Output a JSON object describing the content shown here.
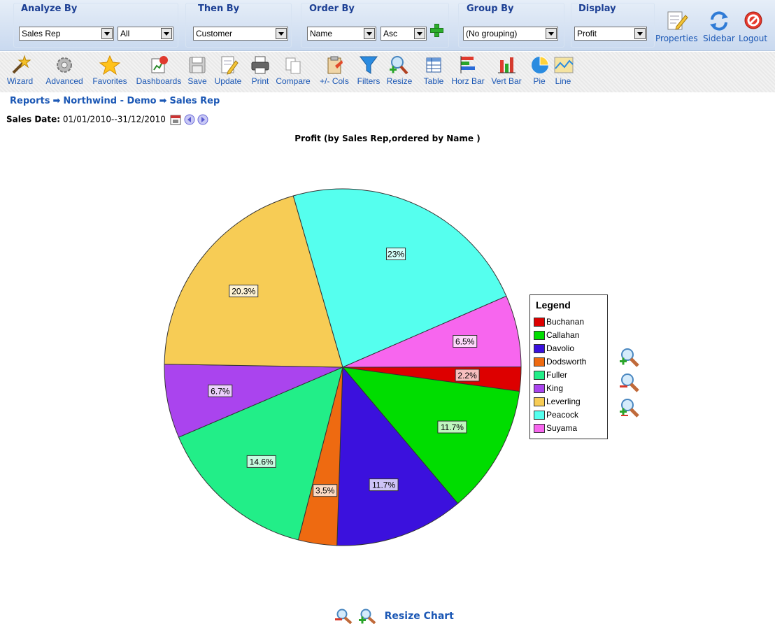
{
  "controls": {
    "analyze_by": {
      "title": "Analyze By",
      "value": "Sales Rep",
      "secondary": "All"
    },
    "then_by": {
      "title": "Then By",
      "value": "Customer"
    },
    "order_by": {
      "title": "Order By",
      "value": "Name",
      "direction": "Asc"
    },
    "group_by": {
      "title": "Group By",
      "value": "(No grouping)"
    },
    "display": {
      "title": "Display",
      "value": "Profit"
    }
  },
  "top_right": [
    {
      "label": "Properties",
      "icon": "properties-icon"
    },
    {
      "label": "Sidebar",
      "icon": "sidebar-refresh-icon"
    },
    {
      "label": "Logout",
      "icon": "logout-icon"
    }
  ],
  "toolbar": [
    {
      "label": "Wizard",
      "icon": "wizard-wand-icon"
    },
    {
      "label": "Advanced",
      "icon": "gear-icon"
    },
    {
      "label": "Favorites",
      "icon": "star-icon"
    },
    {
      "label": "Dashboards",
      "icon": "dashboard-icon"
    },
    {
      "label": "Save",
      "icon": "save-icon"
    },
    {
      "label": "Update",
      "icon": "update-icon"
    },
    {
      "label": "Print",
      "icon": "printer-icon"
    },
    {
      "label": "Compare",
      "icon": "compare-icon"
    },
    {
      "label": "+/- Cols",
      "icon": "columns-icon"
    },
    {
      "label": "Filters",
      "icon": "filter-icon"
    },
    {
      "label": "Resize",
      "icon": "resize-icon"
    },
    {
      "label": "Table",
      "icon": "table-icon"
    },
    {
      "label": "Horz Bar",
      "icon": "horizontal-bar-chart-icon"
    },
    {
      "label": "Vert Bar",
      "icon": "vertical-bar-chart-icon"
    },
    {
      "label": "Pie",
      "icon": "pie-chart-icon"
    },
    {
      "label": "Line",
      "icon": "line-chart-icon"
    }
  ],
  "breadcrumb": {
    "items": [
      "Reports",
      "Northwind - Demo",
      "Sales Rep"
    ],
    "separator": "➡"
  },
  "date_filter": {
    "label": "Sales Date:",
    "value": "01/01/2010--31/12/2010"
  },
  "chart_data": {
    "type": "pie",
    "title": "Profit (by Sales Rep,ordered by Name )",
    "legend_title": "Legend",
    "legend_position": "right",
    "start_angle_note": "",
    "slices": [
      {
        "name": "Buchanan",
        "value": 2.2,
        "label": "2.2%",
        "color": "#dd0000"
      },
      {
        "name": "Callahan",
        "value": 11.7,
        "label": "11.7%",
        "color": "#00dd00"
      },
      {
        "name": "Davolio",
        "value": 11.7,
        "label": "11.7%",
        "color": "#3b11dd"
      },
      {
        "name": "Dodsworth",
        "value": 3.5,
        "label": "3.5%",
        "color": "#ee6a11"
      },
      {
        "name": "Fuller",
        "value": 14.6,
        "label": "14.6%",
        "color": "#22ee88"
      },
      {
        "name": "King",
        "value": 6.7,
        "label": "6.7%",
        "color": "#aa44ee"
      },
      {
        "name": "Leverling",
        "value": 20.3,
        "label": "20.3%",
        "color": "#f7cc55"
      },
      {
        "name": "Peacock",
        "value": 23,
        "label": "23%",
        "color": "#55ffee"
      },
      {
        "name": "Suyama",
        "value": 6.5,
        "label": "6.5%",
        "color": "#f766ee"
      }
    ]
  },
  "resize_chart_label": "Resize Chart"
}
